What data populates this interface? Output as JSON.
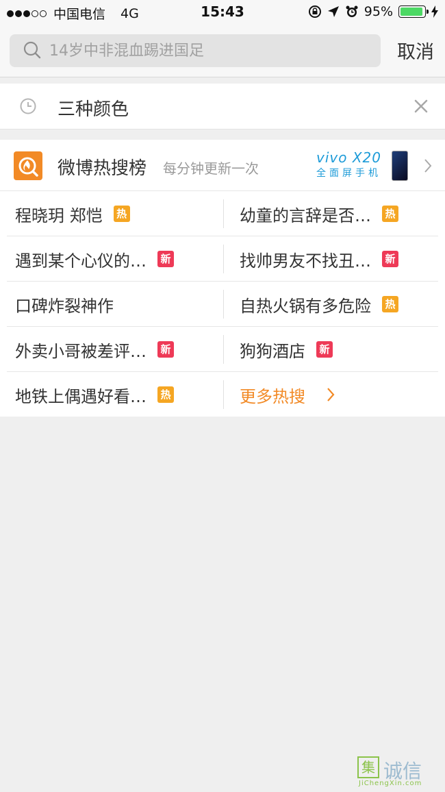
{
  "status_bar": {
    "carrier": "中国电信",
    "network": "4G",
    "time": "15:43",
    "battery_percent": "95%",
    "battery_level": 0.95
  },
  "search": {
    "placeholder": "14岁中非混血踢进国足",
    "cancel_label": "取消"
  },
  "history": {
    "items": [
      {
        "text": "三种颜色"
      }
    ]
  },
  "hot_search": {
    "title": "微博热搜榜",
    "subtitle": "每分钟更新一次",
    "ad": {
      "brand": "vivo X20",
      "tagline": "全面屏手机"
    },
    "rows": [
      {
        "left": {
          "text": "程晓玥 郑恺",
          "badge": "热"
        },
        "right": {
          "text": "幼童的言辞是否…",
          "badge": "热"
        }
      },
      {
        "left": {
          "text": "遇到某个心仪的…",
          "badge": "新"
        },
        "right": {
          "text": "找帅男友不找丑…",
          "badge": "新"
        }
      },
      {
        "left": {
          "text": "口碑炸裂神作",
          "badge": ""
        },
        "right": {
          "text": "自热火锅有多危险",
          "badge": "热"
        }
      },
      {
        "left": {
          "text": "外卖小哥被差评…",
          "badge": "新"
        },
        "right": {
          "text": "狗狗酒店",
          "badge": "新"
        }
      },
      {
        "left": {
          "text": "地铁上偶遇好看…",
          "badge": "热"
        }
      }
    ],
    "more_label": "更多热搜"
  },
  "watermark": {
    "mark": "集",
    "text": "诚信",
    "url": "JiChengXin.com"
  },
  "colors": {
    "accent_orange": "#f28a26",
    "hot_badge": "#f5a623",
    "new_badge": "#ee3a57",
    "vivo_blue": "#1d9bd8"
  }
}
